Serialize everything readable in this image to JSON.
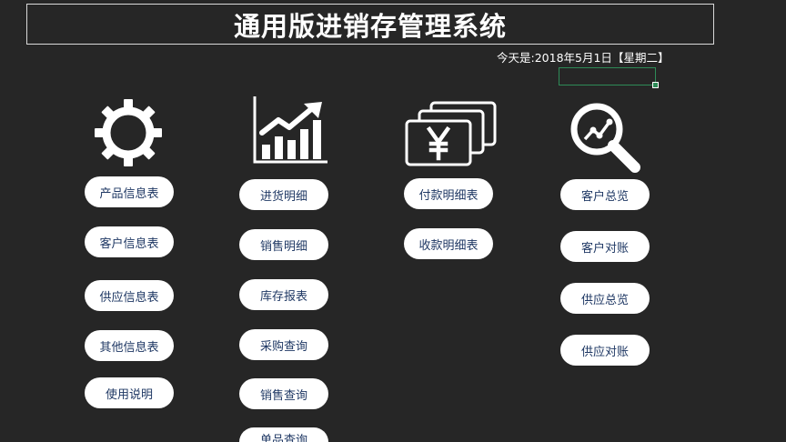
{
  "header": {
    "title": "通用版进销存管理系统"
  },
  "date": {
    "label": "今天是:",
    "value": "2018年5月1日",
    "weekday": "【星期二】"
  },
  "columns": [
    {
      "icon": "gear-icon",
      "buttons": [
        "产品信息表",
        "客户信息表",
        "供应信息表",
        "其他信息表",
        "使用说明"
      ]
    },
    {
      "icon": "bar-chart-icon",
      "buttons": [
        "进货明细",
        "销售明细",
        "库存报表",
        "采购查询",
        "销售查询",
        "单品查询"
      ]
    },
    {
      "icon": "yen-bills-icon",
      "buttons": [
        "付款明细表",
        "收款明细表"
      ]
    },
    {
      "icon": "magnifier-chart-icon",
      "buttons": [
        "客户总览",
        "客户对账",
        "供应总览",
        "供应对账"
      ]
    }
  ]
}
